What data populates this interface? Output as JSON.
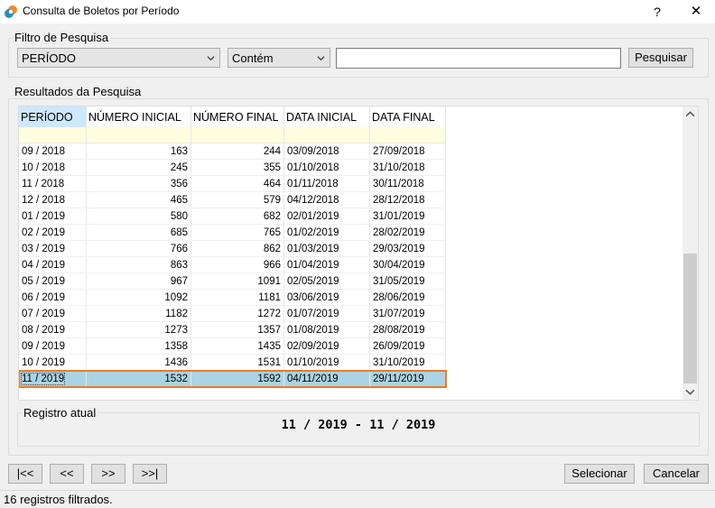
{
  "window": {
    "title": "Consulta de Boletos por Período",
    "help": "?",
    "close": "✕"
  },
  "filter": {
    "legend": "Filtro de Pesquisa",
    "field": "PERÍODO",
    "operator": "Contém",
    "search_value": "",
    "search_button": "Pesquisar"
  },
  "results": {
    "legend": "Resultados da Pesquisa",
    "columns": [
      "PERÍODO",
      "NÚMERO INICIAL",
      "NÚMERO FINAL",
      "DATA INICIAL",
      "DATA FINAL"
    ],
    "rows": [
      [
        "09 / 2018",
        "163",
        "244",
        "03/09/2018",
        "27/09/2018"
      ],
      [
        "10 / 2018",
        "245",
        "355",
        "01/10/2018",
        "31/10/2018"
      ],
      [
        "11 / 2018",
        "356",
        "464",
        "01/11/2018",
        "30/11/2018"
      ],
      [
        "12 / 2018",
        "465",
        "579",
        "04/12/2018",
        "28/12/2018"
      ],
      [
        "01 / 2019",
        "580",
        "682",
        "02/01/2019",
        "31/01/2019"
      ],
      [
        "02 / 2019",
        "685",
        "765",
        "01/02/2019",
        "28/02/2019"
      ],
      [
        "03 / 2019",
        "766",
        "862",
        "01/03/2019",
        "29/03/2019"
      ],
      [
        "04 / 2019",
        "863",
        "966",
        "01/04/2019",
        "30/04/2019"
      ],
      [
        "05 / 2019",
        "967",
        "1091",
        "02/05/2019",
        "31/05/2019"
      ],
      [
        "06 / 2019",
        "1092",
        "1181",
        "03/06/2019",
        "28/06/2019"
      ],
      [
        "07 / 2019",
        "1182",
        "1272",
        "01/07/2019",
        "31/07/2019"
      ],
      [
        "08 / 2019",
        "1273",
        "1357",
        "01/08/2019",
        "28/08/2019"
      ],
      [
        "09 / 2019",
        "1358",
        "1435",
        "02/09/2019",
        "26/09/2019"
      ],
      [
        "10 / 2019",
        "1436",
        "1531",
        "01/10/2019",
        "31/10/2019"
      ],
      [
        "11 / 2019",
        "1532",
        "1592",
        "04/11/2019",
        "29/11/2019"
      ]
    ],
    "selected_index": 14
  },
  "current": {
    "legend": "Registro atual",
    "value": "11 / 2019 - 11 / 2019"
  },
  "nav": {
    "first": "|<<",
    "prev": "<<",
    "next": ">>",
    "last": ">>|"
  },
  "actions": {
    "select": "Selecionar",
    "cancel": "Cancelar"
  },
  "status": {
    "text": "16 registros filtrados."
  },
  "colors": {
    "accent_icon": "#e8772e",
    "selection": "#aad4e6",
    "selection_border": "#e87b2a",
    "sorted_header": "#cde8ff"
  }
}
